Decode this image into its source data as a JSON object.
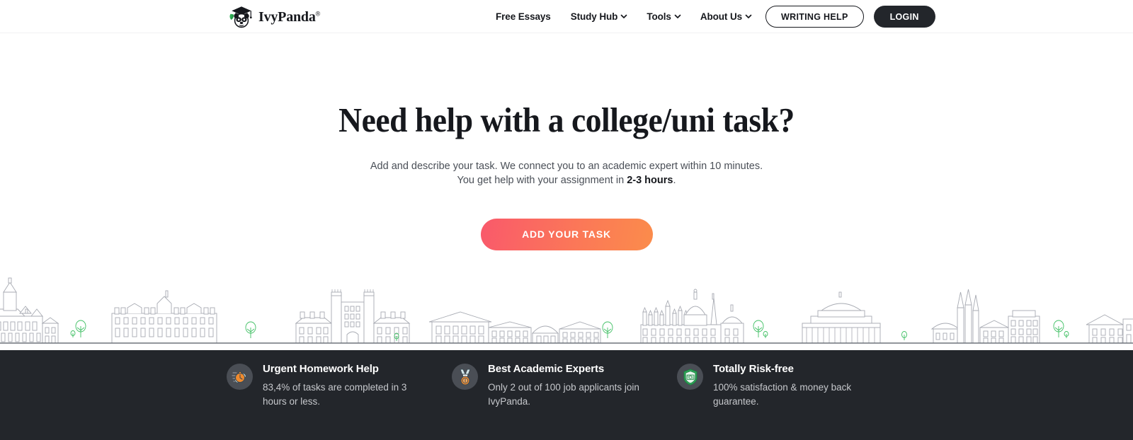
{
  "header": {
    "logo": {
      "name": "IvyPanda",
      "registered_mark": "®",
      "icon": "panda-graduate-icon"
    },
    "nav": [
      {
        "label": "Free Essays",
        "has_dropdown": false
      },
      {
        "label": "Study Hub",
        "has_dropdown": true
      },
      {
        "label": "Tools",
        "has_dropdown": true
      },
      {
        "label": "About Us",
        "has_dropdown": true
      }
    ],
    "writing_help_label": "WRITING HELP",
    "login_label": "LOGIN"
  },
  "hero": {
    "title": "Need help with a college/uni task?",
    "subtitle_line1": "Add and describe your task. We connect you to an academic expert within 10 minutes.",
    "subtitle_line2_prefix": "You get help with your assignment in ",
    "subtitle_line2_strong": "2-3 hours",
    "subtitle_line2_suffix": ".",
    "cta_label": "ADD YOUR TASK"
  },
  "features": [
    {
      "icon": "stopwatch-wrench-icon",
      "title": "Urgent Homework Help",
      "description": "83,4% of tasks are completed in 3 hours or less."
    },
    {
      "icon": "medal-icon",
      "title": "Best Academic Experts",
      "description": "Only 2 out of 100 job applicants join IvyPanda."
    },
    {
      "icon": "shield-money-icon",
      "title": "Totally Risk-free",
      "description": "100% satisfaction & money back guarantee."
    }
  ],
  "colors": {
    "cta_gradient_start": "#F9596B",
    "cta_gradient_end": "#FB8C4B",
    "footer_bg": "#23262B",
    "text_dark": "#16181D",
    "skyline_line": "#A7AAB2",
    "tree_green": "#3FBF63"
  }
}
